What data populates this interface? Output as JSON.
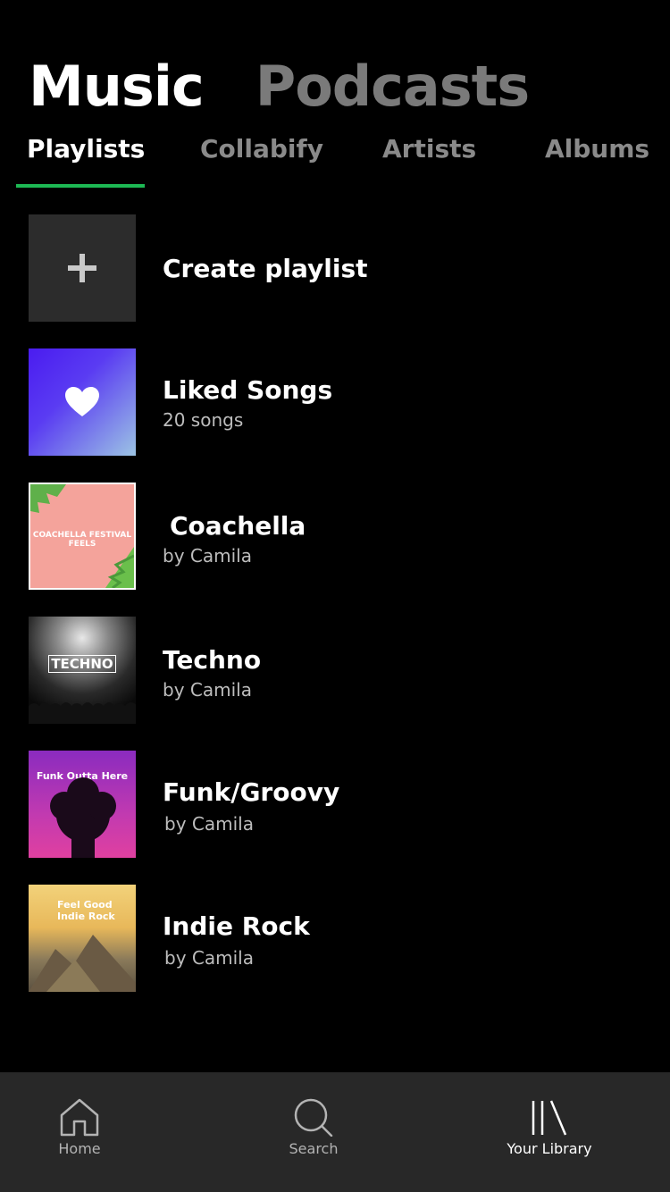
{
  "top_tabs": [
    {
      "label": "Music",
      "active": true
    },
    {
      "label": "Podcasts",
      "active": false
    }
  ],
  "sub_tabs": [
    {
      "label": "Playlists",
      "active": true
    },
    {
      "label": "Collabify",
      "active": false
    },
    {
      "label": "Artists",
      "active": false
    },
    {
      "label": "Albums",
      "active": false
    }
  ],
  "items": [
    {
      "title": "Create playlist",
      "subtitle": "",
      "icon": "plus-icon"
    },
    {
      "title": "Liked Songs",
      "subtitle": "20 songs",
      "icon": "heart-icon"
    },
    {
      "title": "Coachella",
      "subtitle": "by Camila",
      "cover_text": "COACHELLA FESTIVAL FEELS"
    },
    {
      "title": "Techno",
      "subtitle": "by Camila",
      "cover_text": "TECHNO"
    },
    {
      "title": "Funk/Groovy",
      "subtitle": "by Camila",
      "cover_text": "Funk Outta Here"
    },
    {
      "title": "Indie Rock",
      "subtitle": "by Camila",
      "cover_text": "Feel Good Indie Rock"
    }
  ],
  "bottom_nav": [
    {
      "label": "Home",
      "icon": "home-icon",
      "active": false
    },
    {
      "label": "Search",
      "icon": "search-icon",
      "active": false
    },
    {
      "label": "Your Library",
      "icon": "library-icon",
      "active": true
    }
  ],
  "colors": {
    "accent": "#1db954",
    "background": "#000000",
    "nav_background": "#282828"
  }
}
